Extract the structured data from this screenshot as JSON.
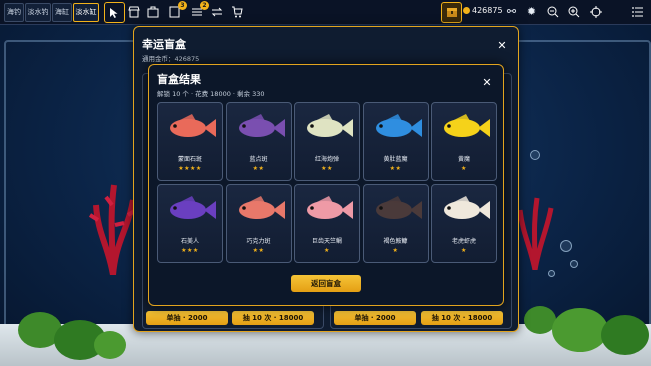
{
  "topbar": {
    "tabs": [
      {
        "label": "海钓",
        "active": false
      },
      {
        "label": "淡水钓",
        "active": false
      },
      {
        "label": "海缸",
        "active": false
      },
      {
        "label": "淡水缸",
        "active": true
      }
    ],
    "tools": [
      {
        "icon": "cursor-icon",
        "active": true
      },
      {
        "icon": "shop-icon",
        "active": false
      },
      {
        "icon": "inventory-icon",
        "active": false
      },
      {
        "icon": "tasks-icon",
        "badge": "3"
      },
      {
        "icon": "list-icon",
        "badge": "2"
      },
      {
        "icon": "swap-icon"
      },
      {
        "icon": "cart-icon"
      }
    ],
    "coins": "426875",
    "right_icons": [
      "link-icon",
      "settings-icon",
      "zoom-out-icon",
      "zoom-in-icon",
      "focus-icon",
      "menu-icon"
    ]
  },
  "outer_dialog": {
    "title": "幸运盲盒",
    "currency_label": "通用金币：426875",
    "buttons": [
      "单抽 · 2000",
      "抽 10 次 · 18000",
      "单抽 · 2000",
      "抽 10 次 · 18000"
    ]
  },
  "result_dialog": {
    "title": "盲盒结果",
    "summary": "解锁 10 个 · 花费 18000 · 剩余 330",
    "return_label": "返回盲盒",
    "fish": [
      {
        "name": "蒙面石斑",
        "stars": "★★★★",
        "color": "#e96a5a"
      },
      {
        "name": "蓝点斑",
        "stars": "★★",
        "color": "#7a4fb0"
      },
      {
        "name": "红海炮弹",
        "stars": "★★",
        "color": "#dfe3c2"
      },
      {
        "name": "黄肚蓝魔",
        "stars": "★★",
        "color": "#2f8ee0"
      },
      {
        "name": "黄魔",
        "stars": "★",
        "color": "#f5d21a"
      },
      {
        "name": "石美人",
        "stars": "★★★",
        "color": "#6a3fc0"
      },
      {
        "name": "巧克力斑",
        "stars": "★★",
        "color": "#e8786a"
      },
      {
        "name": "巨齿天竺鲷",
        "stars": "★",
        "color": "#ee9aa6"
      },
      {
        "name": "褐色鮟鱇",
        "stars": "★",
        "color": "#4a3a3a"
      },
      {
        "name": "老虎虾虎",
        "stars": "★",
        "color": "#efe8dc"
      }
    ]
  }
}
